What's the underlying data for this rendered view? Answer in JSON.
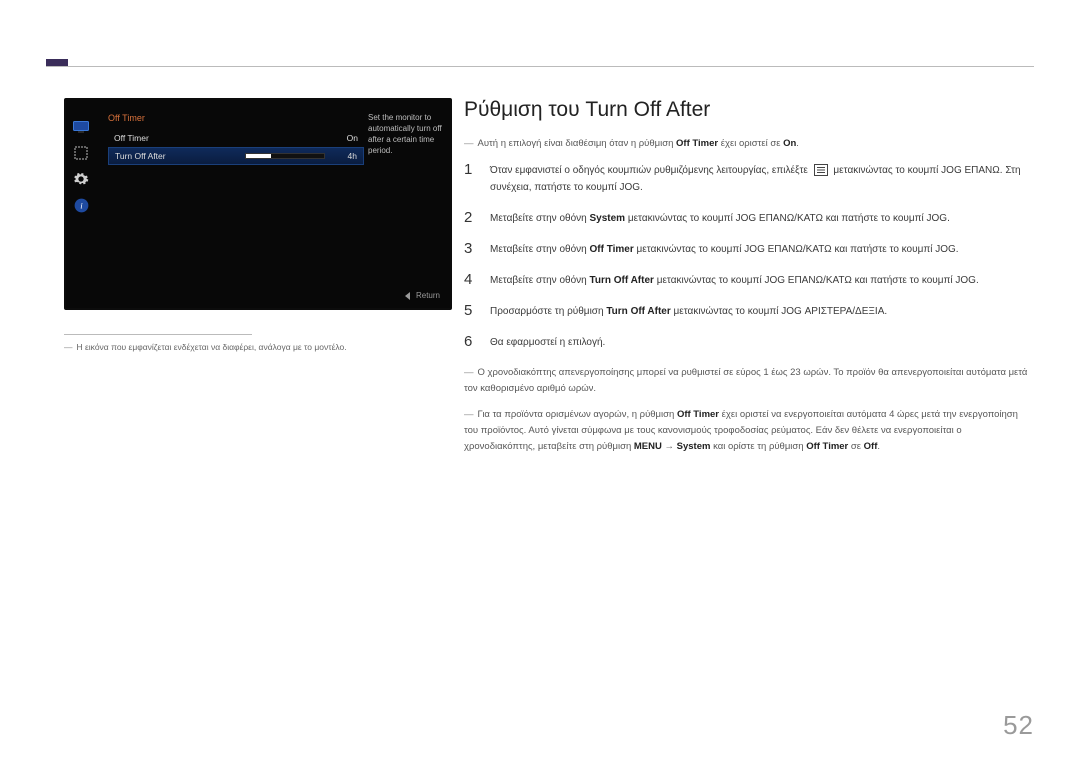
{
  "osd": {
    "title": "Off Timer",
    "row1_label": "Off Timer",
    "row1_value": "On",
    "row2_label": "Turn Off After",
    "row2_value": "4h",
    "desc": "Set the monitor to automatically turn off after a certain time period.",
    "return": "Return"
  },
  "left_note": "Η εικόνα που εμφανίζεται ενδέχεται να διαφέρει, ανάλογα με το μοντέλο.",
  "title": "Ρύθμιση του Turn Off After",
  "intro": {
    "pre": "Αυτή η επιλογή είναι διαθέσιμη όταν η ρύθμιση ",
    "hl": "Off Timer",
    "mid": " έχει οριστεί σε ",
    "hl2": "On",
    "post": "."
  },
  "steps": [
    {
      "pre": "Όταν εμφανιστεί ο οδηγός κουμπιών ρυθμιζόμενης λειτουργίας, επιλέξτε ",
      "post": " μετακινώντας το κουμπί JOG ΕΠΑΝΩ. Στη συνέχεια, πατήστε το κουμπί JOG."
    },
    {
      "pre": "Μεταβείτε στην οθόνη ",
      "hl": "System",
      "post": " μετακινώντας το κουμπί JOG ΕΠΑΝΩ/ΚΑΤΩ και πατήστε το κουμπί JOG."
    },
    {
      "pre": "Μεταβείτε στην οθόνη ",
      "hl": "Off Timer",
      "post": " μετακινώντας το κουμπί JOG ΕΠΑΝΩ/ΚΑΤΩ και πατήστε το κουμπί JOG."
    },
    {
      "pre": "Μεταβείτε στην οθόνη ",
      "hl": "Turn Off After",
      "post": " μετακινώντας το κουμπί JOG ΕΠΑΝΩ/ΚΑΤΩ και πατήστε το κουμπί JOG."
    },
    {
      "pre": "Προσαρμόστε τη ρύθμιση ",
      "hl": "Turn Off After",
      "post": " μετακινώντας το κουμπί JOG ΑΡΙΣΤΕΡΑ/ΔΕΞΙΑ."
    },
    {
      "pre": "Θα εφαρμοστεί η επιλογή."
    }
  ],
  "foot1": "Ο χρονοδιακόπτης απενεργοποίησης μπορεί να ρυθμιστεί σε εύρος 1 έως 23 ωρών. Το προϊόν θα απενεργοποιείται αυτόματα μετά τον καθορισμένο αριθμό ωρών.",
  "foot2": {
    "p1": "Για τα προϊόντα ορισμένων αγορών, η ρύθμιση ",
    "h1": "Off Timer",
    "p2": " έχει οριστεί να ενεργοποιείται αυτόματα 4 ώρες μετά την ενεργοποίηση του προϊόντος. Αυτό γίνεται σύμφωνα με τους κανονισμούς τροφοδοσίας ρεύματος. Εάν δεν θέλετε να ενεργοποιείται ο χρονοδιακόπτης, μεταβείτε στη ρύθμιση ",
    "h2": "MENU",
    "p3": " → ",
    "h3": "System",
    "p4": " και ορίστε τη ρύθμιση ",
    "h4": "Off Timer",
    "p5": " σε ",
    "h5": "Off",
    "p6": "."
  },
  "page": "52"
}
